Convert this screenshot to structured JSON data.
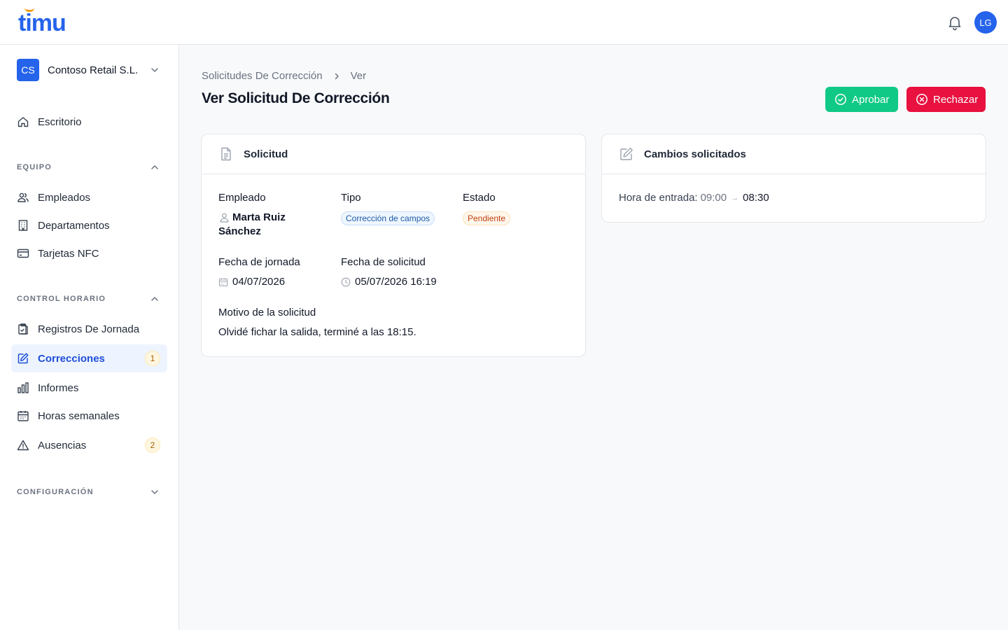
{
  "app": {
    "logo_text": "timu",
    "user_initials": "LG",
    "brand_color": "#2563eb"
  },
  "sidebar": {
    "org_initials": "CS",
    "org_name": "Contoso Retail S.L.",
    "dashboard_label": "Escritorio",
    "sections": {
      "team": "EQUIPO",
      "time": "CONTROL HORARIO",
      "config": "CONFIGURACIÓN"
    },
    "items": {
      "employees": "Empleados",
      "departments": "Departamentos",
      "nfc": "Tarjetas NFC",
      "records": "Registros De Jornada",
      "corrections": "Correcciones",
      "corrections_badge": "1",
      "reports": "Informes",
      "weekly_hours": "Horas semanales",
      "absences": "Ausencias",
      "absences_badge": "2"
    }
  },
  "header": {
    "breadcrumb_parent": "Solicitudes De Corrección",
    "breadcrumb_current": "Ver",
    "title": "Ver Solicitud De Corrección",
    "approve_label": "Aprobar",
    "reject_label": "Rechazar",
    "approve_color": "#10c986",
    "reject_color": "#e8113f"
  },
  "request": {
    "card_title": "Solicitud",
    "employee_label": "Empleado",
    "employee_name": "Marta Ruiz Sánchez",
    "type_label": "Tipo",
    "type_value": "Corrección de campos",
    "status_label": "Estado",
    "status_value": "Pendiente",
    "workday_date_label": "Fecha de jornada",
    "workday_date": "04/07/2026",
    "request_date_label": "Fecha de solicitud",
    "request_date": "05/07/2026 16:19",
    "reason_label": "Motivo de la solicitud",
    "reason_text": "Olvidé fichar la salida, terminé a las 18:15."
  },
  "changes": {
    "card_title": "Cambios solicitados",
    "field_label": "Hora de entrada:",
    "old_value": "09:00",
    "arrow": "→",
    "new_value": "08:30"
  }
}
